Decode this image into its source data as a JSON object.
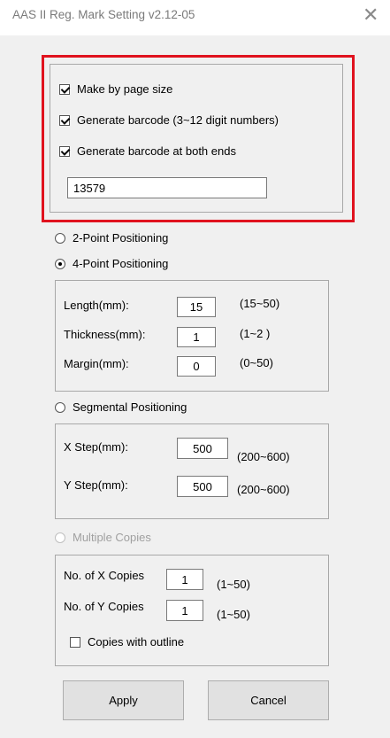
{
  "window": {
    "title": "AAS II Reg. Mark Setting v2.12-05",
    "close_glyph": "✕"
  },
  "barcode_group": {
    "options": [
      {
        "label": "Make by page size",
        "checked": true
      },
      {
        "label": "Generate barcode (3~12 digit numbers)",
        "checked": true
      },
      {
        "label": "Generate barcode at both ends",
        "checked": true
      }
    ],
    "barcode_value": "13579"
  },
  "positioning": {
    "two_point": {
      "label": "2-Point Positioning",
      "selected": false
    },
    "four_point": {
      "label": "4-Point Positioning",
      "selected": true
    },
    "segmental": {
      "label": "Segmental Positioning",
      "selected": false
    },
    "multiple": {
      "label": "Multiple Copies",
      "selected": false,
      "enabled": false
    }
  },
  "four_point_fields": [
    {
      "label": "Length(mm):",
      "value": "15",
      "range": "(15~50)"
    },
    {
      "label": "Thickness(mm):",
      "value": "1",
      "range": "(1~2 )"
    },
    {
      "label": "Margin(mm):",
      "value": "0",
      "range": "(0~50)"
    }
  ],
  "segmental_fields": [
    {
      "label": "X Step(mm):",
      "value": "500",
      "range": "(200~600)"
    },
    {
      "label": "Y Step(mm):",
      "value": "500",
      "range": "(200~600)"
    }
  ],
  "copies_fields": [
    {
      "label": "No. of X Copies",
      "value": "1",
      "range": "(1~50)"
    },
    {
      "label": "No. of Y Copies",
      "value": "1",
      "range": "(1~50)"
    }
  ],
  "copies_outline": {
    "label": "Copies with outline",
    "checked": false
  },
  "buttons": {
    "apply": "Apply",
    "cancel": "Cancel"
  }
}
